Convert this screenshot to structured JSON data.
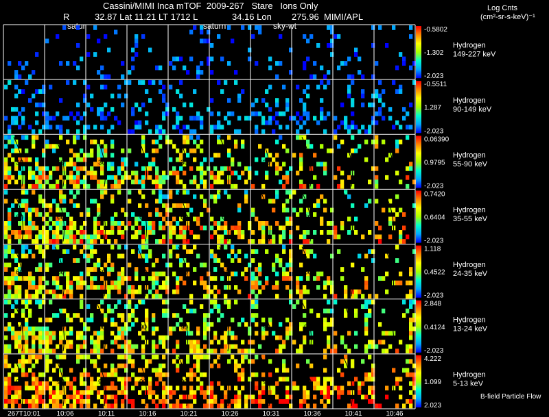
{
  "header": {
    "title": "Cassini/MIMI Inca mTOF  2009-267   Stare   Ions Only",
    "line2_r": "R",
    "line2_a": "32.87 Lat 11.21 LT 1712 L",
    "line2_b": "34.16 Lon",
    "line2_c": "275.96  MIMI/APL",
    "overlay_1": "satur",
    "overlay_2": "saturn",
    "overlay_3": "sky-wt",
    "units_line1": "Log Cnts",
    "units_line2": "(cm²-sr-s-keV)⁻¹"
  },
  "footer": {
    "bfield_label": "B-field Particle Flow"
  },
  "chart_data": {
    "type": "heatmap",
    "title": "Cassini/MIMI Inca mTOF  2009-267   Stare   Ions Only",
    "time_labels": [
      "267T10:01",
      "10:06",
      "10:11",
      "10:16",
      "10:21",
      "10:26",
      "10:31",
      "10:36",
      "10:41",
      "10:46"
    ],
    "colorbar_colors": [
      "#0000ff",
      "#00aaff",
      "#00ffcc",
      "#aaff00",
      "#ffff00",
      "#ff8800",
      "#ff0000"
    ],
    "rows": [
      {
        "species": "Hydrogen",
        "energy": "149-227 keV",
        "cb_top": "-0.5802",
        "cb_mid": "-1.302",
        "cb_bot": "-2.023",
        "density": 0.12,
        "base": 0.05,
        "spread": 0.25
      },
      {
        "species": "Hydrogen",
        "energy": "90-149 keV",
        "cb_top": "-0.5511",
        "cb_mid": "1.287",
        "cb_bot": "-2.023",
        "density": 0.28,
        "base": 0.08,
        "spread": 0.3
      },
      {
        "species": "Hydrogen",
        "energy": "55-90 keV",
        "cb_top": "0.06390",
        "cb_mid": "0.9795",
        "cb_bot": "-2.023",
        "density": 0.55,
        "base": 0.3,
        "spread": 0.7
      },
      {
        "species": "Hydrogen",
        "energy": "35-55 keV",
        "cb_top": "0.7420",
        "cb_mid": "0.6404",
        "cb_bot": "-2.023",
        "density": 0.62,
        "base": 0.35,
        "spread": 0.65
      },
      {
        "species": "Hydrogen",
        "energy": "24-35 keV",
        "cb_top": "1.118",
        "cb_mid": "0.4522",
        "cb_bot": "-2.023",
        "density": 0.6,
        "base": 0.35,
        "spread": 0.6
      },
      {
        "species": "Hydrogen",
        "energy": "13-24 keV",
        "cb_top": "2.848",
        "cb_mid": "0.4124",
        "cb_bot": "-2.023",
        "density": 0.62,
        "base": 0.35,
        "spread": 0.5
      },
      {
        "species": "Hydrogen",
        "energy": "5-13 keV",
        "cb_top": "4.222",
        "cb_mid": "1.099",
        "cb_bot": "2.023",
        "density": 0.75,
        "base": 0.55,
        "spread": 0.45
      }
    ],
    "contour_labels": [
      "30",
      "60",
      "90"
    ]
  }
}
